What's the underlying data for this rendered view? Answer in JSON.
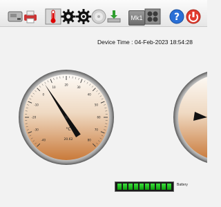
{
  "toolbar": {
    "buttons": [
      {
        "name": "card-reader-icon"
      },
      {
        "name": "printer-icon"
      },
      {
        "name": "thermometer-icon"
      },
      {
        "name": "settings-gear-icon"
      },
      {
        "name": "advanced-gear-icon"
      },
      {
        "name": "disc-icon"
      },
      {
        "name": "download-icon"
      }
    ],
    "mk1_label": "Mk1",
    "extra_buttons": [
      {
        "name": "grid-icon"
      },
      {
        "name": "help-icon"
      },
      {
        "name": "exit-icon"
      }
    ]
  },
  "device_time": "Device Time : 04-Feb-2023 18:54:28",
  "gauge": {
    "unit": "°C",
    "value_text": "20.62",
    "value": 20.62,
    "ticks": [
      "-40",
      "-30",
      "-20",
      "-10",
      "0",
      "10",
      "20",
      "30",
      "40",
      "50",
      "60",
      "70",
      "80"
    ],
    "colors": {
      "face_top": "#fdfaf6",
      "face_bottom": "#c97a3a",
      "needle": "#111111"
    }
  },
  "battery": {
    "label": "Battery",
    "level": 1.0,
    "cells": 10
  }
}
